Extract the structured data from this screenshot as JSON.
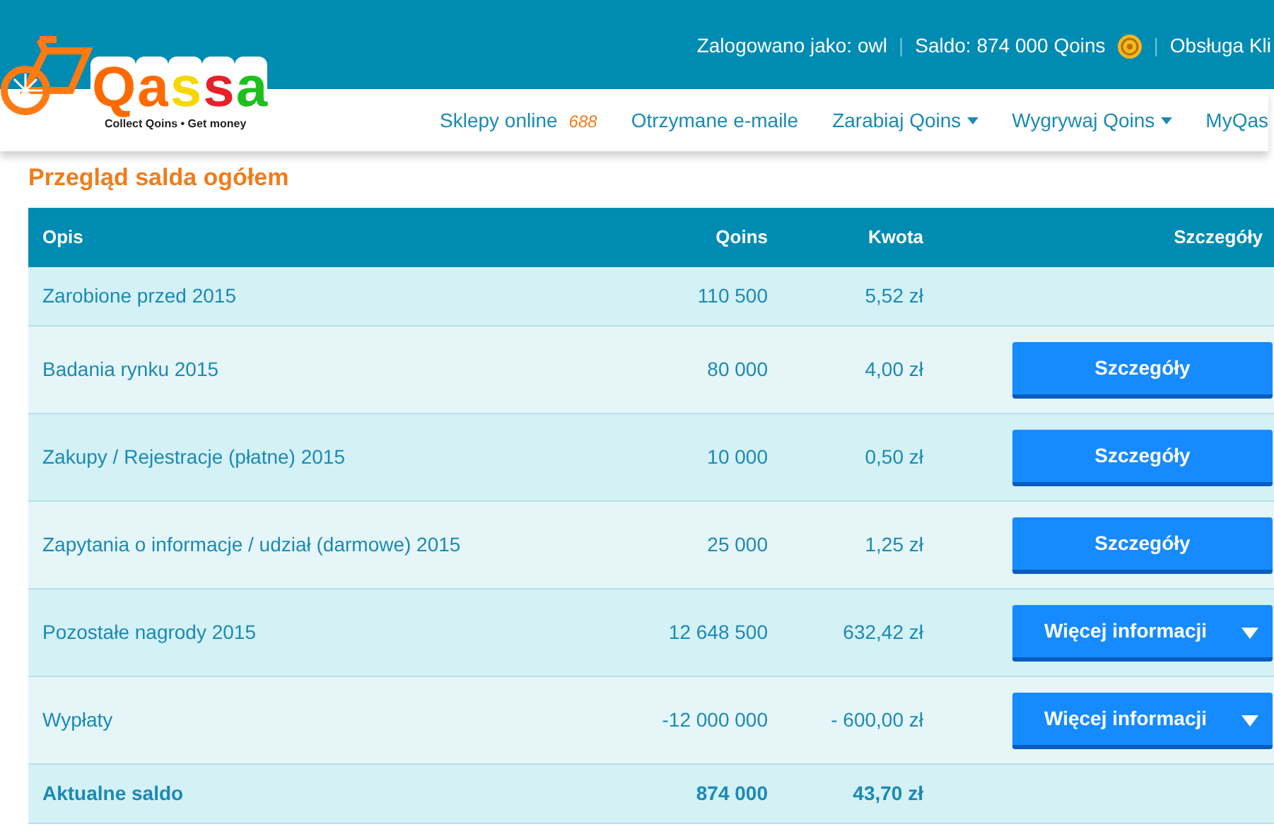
{
  "logo": {
    "letters": [
      {
        "text": "Q",
        "color": "#ff6a00"
      },
      {
        "text": "a",
        "color": "#ff6a00"
      },
      {
        "text": "s",
        "color": "#f5d800"
      },
      {
        "text": "s",
        "color": "#e8202a"
      },
      {
        "text": "a",
        "color": "#1fbf1f"
      }
    ],
    "tagline": "Collect Qoins • Get money"
  },
  "topbar": [
    {
      "kind": "text",
      "text": "Zalogowano jako: owl"
    },
    {
      "kind": "separator",
      "text": "|"
    },
    {
      "kind": "text",
      "text": "Saldo: 874 000 Qoins",
      "coin": true
    },
    {
      "kind": "separator",
      "text": "|"
    },
    {
      "kind": "link",
      "text": "Obsługa Kli"
    }
  ],
  "nav": [
    {
      "label": "Sklepy online",
      "count": "688",
      "dropdown": false
    },
    {
      "label": "Otrzymane e-maile",
      "dropdown": false
    },
    {
      "label": "Zarabiaj Qoins",
      "dropdown": true
    },
    {
      "label": "Wygrywaj Qoins",
      "dropdown": true
    },
    {
      "label": "MyQas",
      "dropdown": false
    }
  ],
  "heading": "Przegląd salda ogółem",
  "table": {
    "columns": [
      "Opis",
      "Qoins",
      "Kwota",
      "Szczegóły"
    ],
    "rows": [
      {
        "kind": "item",
        "description": "Zarobione przed 2015",
        "qoins": "110 500",
        "amount": "5,52 zł"
      },
      {
        "kind": "item",
        "description": "Badania rynku 2015",
        "qoins": "80 000",
        "amount": "4,00 zł",
        "action": {
          "kind": "details",
          "label": "Szczegóły"
        }
      },
      {
        "kind": "item",
        "description": "Zakupy / Rejestracje (płatne) 2015",
        "qoins": "10 000",
        "amount": "0,50 zł",
        "action": {
          "kind": "details",
          "label": "Szczegóły"
        }
      },
      {
        "kind": "item",
        "description": "Zapytania o informacje / udział (darmowe) 2015",
        "qoins": "25 000",
        "amount": "1,25 zł",
        "action": {
          "kind": "details",
          "label": "Szczegóły"
        }
      },
      {
        "kind": "item",
        "description": "Pozostałe nagrody 2015",
        "qoins": "12 648 500",
        "amount": "632,42 zł",
        "action": {
          "kind": "more",
          "label": "Więcej informacji"
        }
      },
      {
        "kind": "item",
        "description": "Wypłaty",
        "qoins": "-12 000 000",
        "amount": "- 600,00 zł",
        "action": {
          "kind": "more",
          "label": "Więcej informacji"
        }
      },
      {
        "kind": "total",
        "description": "Aktualne saldo",
        "qoins": "874 000",
        "amount": "43,70 zł"
      }
    ]
  }
}
